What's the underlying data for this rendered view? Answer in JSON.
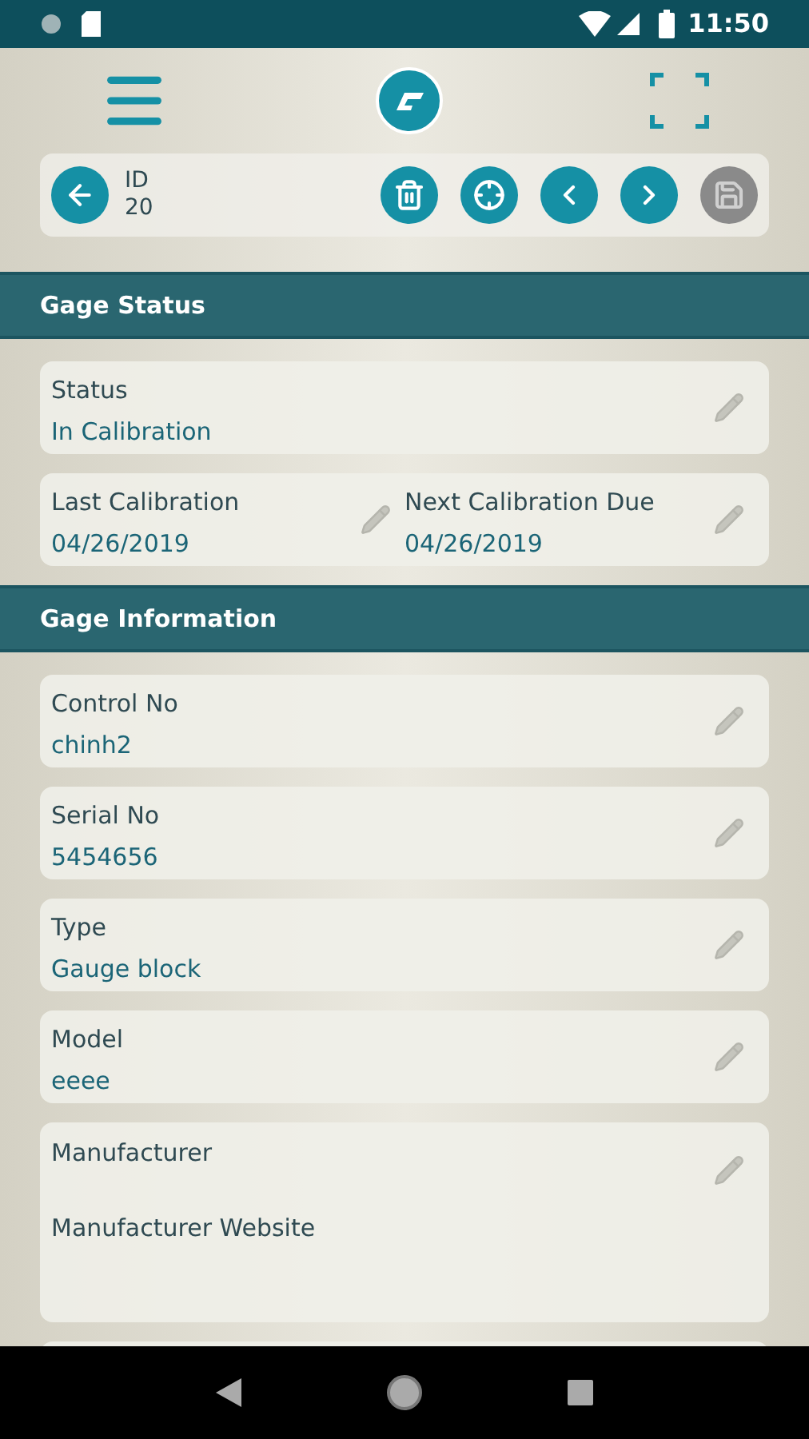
{
  "status_bar": {
    "time": "11:50"
  },
  "toolbar": {
    "id_label": "ID",
    "id_value": "20",
    "buttons": [
      {
        "kind": "delete",
        "disabled": false
      },
      {
        "kind": "locate",
        "disabled": false
      },
      {
        "kind": "previous",
        "disabled": false
      },
      {
        "kind": "next",
        "disabled": false
      },
      {
        "kind": "save",
        "disabled": true
      }
    ]
  },
  "sections": [
    {
      "title": "Gage Status",
      "cards": [
        {
          "kind": "row",
          "fields": [
            {
              "label": "Status",
              "value": "In Calibration"
            }
          ]
        },
        {
          "kind": "row",
          "fields": [
            {
              "label": "Last Calibration",
              "value": "04/26/2019"
            },
            {
              "label": "Next Calibration Due",
              "value": "04/26/2019"
            }
          ]
        }
      ]
    },
    {
      "title": "Gage Information",
      "cards": [
        {
          "kind": "row",
          "fields": [
            {
              "label": "Control No",
              "value": "chinh2"
            }
          ]
        },
        {
          "kind": "row",
          "fields": [
            {
              "label": "Serial No",
              "value": "5454656"
            }
          ]
        },
        {
          "kind": "row",
          "fields": [
            {
              "label": "Type",
              "value": "Gauge block"
            }
          ]
        },
        {
          "kind": "row",
          "fields": [
            {
              "label": "Model",
              "value": "eeee"
            }
          ]
        },
        {
          "kind": "stacked",
          "fields": [
            {
              "label": "Manufacturer"
            },
            {
              "label": "Manufacturer Website"
            }
          ]
        },
        {
          "kind": "partial"
        }
      ]
    }
  ]
}
